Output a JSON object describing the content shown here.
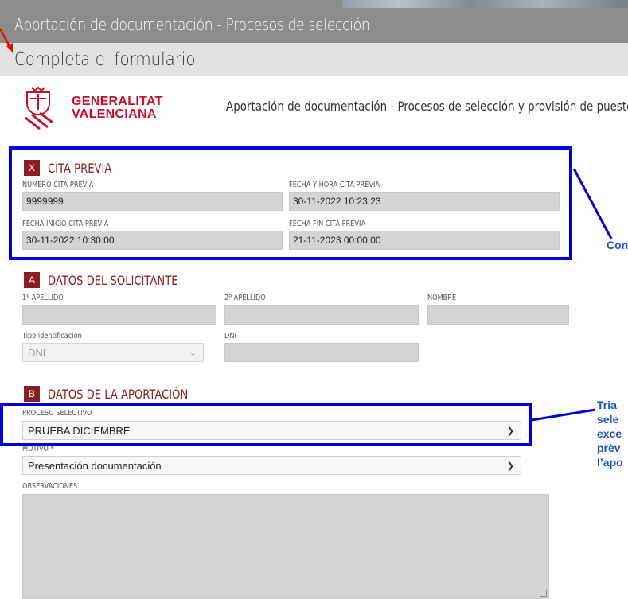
{
  "header": {
    "title": "Aportación de documentación - Procesos de selección"
  },
  "subheader": {
    "title": "Completa el formulario"
  },
  "logo": {
    "line1": "GENERALITAT",
    "line2": "VALENCIANA"
  },
  "page_subtitle": "Aportación de documentación - Procesos de selección y provisión de puestos",
  "cita_previa": {
    "letter": "X",
    "title": "CITA PREVIA",
    "numero_label": "NUMERO CITA PREVIA",
    "numero_value": "9999999",
    "fecha_hora_label": "FECHA Y HORA CITA PREVIA",
    "fecha_hora_value": "30-11-2022 10:23:23",
    "fecha_inicio_label": "FECHA INICIO CITA PREVIA",
    "fecha_inicio_value": "30-11-2022 10:30:00",
    "fecha_fin_label": "FECHA FIN CITA PREVIA",
    "fecha_fin_value": "21-11-2023 00:00:00"
  },
  "solicitante": {
    "letter": "A",
    "title": "DATOS DEL SOLICITANTE",
    "apellido1_label": "1º APELLIDO",
    "apellido2_label": "2º APELLIDO",
    "nombre_label": "NOMBRE",
    "tipo_label": "Tipo identificación",
    "tipo_value": "DNI",
    "dni_label": "DNI"
  },
  "aportacion": {
    "letter": "B",
    "title": "DATOS DE LA APORTACIÓN",
    "proceso_label": "PROCESO SELECTIVO",
    "proceso_value": "PRUEBA DICIEMBRE",
    "motivo_label": "MOTIVO *",
    "motivo_value": "Presentación documentación",
    "observaciones_label": "OBSERVACIONES"
  },
  "annotations": {
    "callout1": "Con",
    "callout2_lines": [
      "Tria",
      "sele",
      "exce",
      "prèv",
      "l’apo"
    ]
  },
  "colors": {
    "accent": "#8a1f22",
    "brand_red": "#c8102e",
    "highlight": "#0000d8",
    "callout": "#1f4fcf"
  },
  "icons": {
    "chevron": "chevron-down-icon",
    "logo": "generalitat-logo-icon"
  }
}
